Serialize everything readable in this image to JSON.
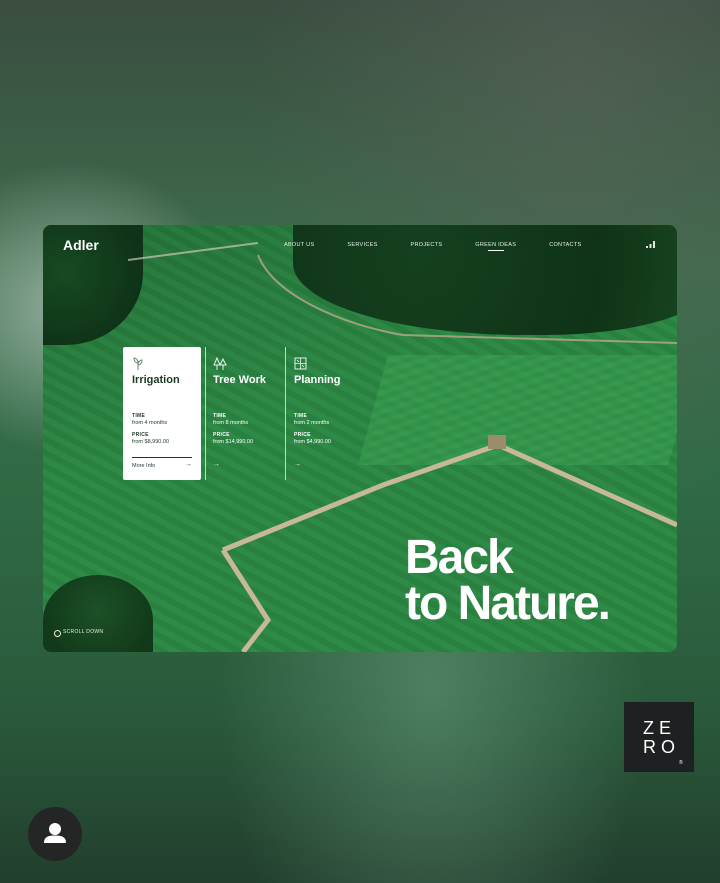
{
  "site": {
    "logo": "Adler"
  },
  "nav": [
    {
      "label": "ABOUT US",
      "active": false
    },
    {
      "label": "SERVICES",
      "active": false
    },
    {
      "label": "PROJECTS",
      "active": false
    },
    {
      "label": "GREEN IDEAS",
      "active": true
    },
    {
      "label": "CONTACTS",
      "active": false
    }
  ],
  "services": [
    {
      "title": "Irrigation",
      "time_label": "TIME",
      "time": "from 4 months",
      "price_label": "PRICE",
      "price": "from $8,990.00",
      "more": "More Info",
      "icon": "sprout-icon"
    },
    {
      "title": "Tree Work",
      "time_label": "TIME",
      "time": "from 8 months",
      "price_label": "PRICE",
      "price": "from $14,990.00",
      "icon": "trees-icon"
    },
    {
      "title": "Planning",
      "time_label": "TIME",
      "time": "from 2 months",
      "price_label": "PRICE",
      "price": "from $4,990.00",
      "icon": "grid-plan-icon"
    }
  ],
  "hero": {
    "line1": "Back",
    "line2": "to Nature."
  },
  "scroll_label": "SCROLL DOWN",
  "badge": {
    "line1": "ZE",
    "line2": "RO",
    "mark": "®"
  },
  "colors": {
    "field_green": "#2e8a47",
    "forest_dark": "#0f3317",
    "badge_bg": "#1e2121"
  }
}
